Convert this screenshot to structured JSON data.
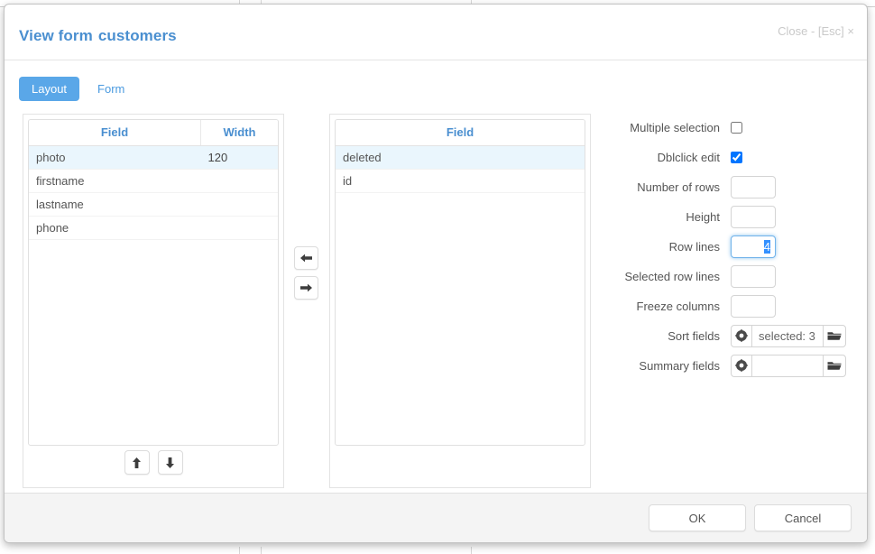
{
  "modal": {
    "title_prefix": "View form",
    "table_name": "customers",
    "close_label": "Close - [Esc] ×"
  },
  "tabs": [
    {
      "label": "Layout",
      "active": true
    },
    {
      "label": "Form",
      "active": false
    }
  ],
  "left_panel": {
    "headers": [
      "Field",
      "Width"
    ],
    "rows": [
      {
        "field": "photo",
        "width": "120",
        "selected": true,
        "cell_selected": true
      },
      {
        "field": "firstname",
        "width": "",
        "selected": false,
        "cell_selected": false
      },
      {
        "field": "lastname",
        "width": "",
        "selected": false,
        "cell_selected": false
      },
      {
        "field": "phone",
        "width": "",
        "selected": false,
        "cell_selected": false
      }
    ],
    "move_up_icon": "arrow-up-icon",
    "move_down_icon": "arrow-down-icon"
  },
  "right_panel": {
    "headers": [
      "Field"
    ],
    "rows": [
      {
        "field": "deleted",
        "selected": true
      },
      {
        "field": "id",
        "selected": false
      }
    ]
  },
  "transfer": {
    "move_left_icon": "arrow-left-icon",
    "move_right_icon": "arrow-right-icon"
  },
  "options": {
    "multiple_selection": {
      "label": "Multiple selection",
      "checked": false
    },
    "dblclick_edit": {
      "label": "Dblclick edit",
      "checked": true
    },
    "number_of_rows": {
      "label": "Number of rows",
      "value": ""
    },
    "height": {
      "label": "Height",
      "value": ""
    },
    "row_lines": {
      "label": "Row lines",
      "value": "4",
      "focused": true,
      "selected": true
    },
    "selected_row_lines": {
      "label": "Selected row lines",
      "value": ""
    },
    "freeze_columns": {
      "label": "Freeze columns",
      "value": ""
    },
    "sort_fields": {
      "label": "Sort fields",
      "value": "selected: 3",
      "clear_icon": "clear-circle-icon",
      "browse_icon": "folder-icon"
    },
    "summary_fields": {
      "label": "Summary fields",
      "value": "",
      "clear_icon": "clear-circle-icon",
      "browse_icon": "folder-icon"
    }
  },
  "footer": {
    "ok_label": "OK",
    "cancel_label": "Cancel"
  },
  "colors": {
    "accent_blue": "#5aa7e8",
    "title_blue": "#4a8fd0",
    "row_highlight": "#eaf6fd",
    "cell_highlight": "#b8dff5",
    "selection_blue": "#3390ff"
  }
}
